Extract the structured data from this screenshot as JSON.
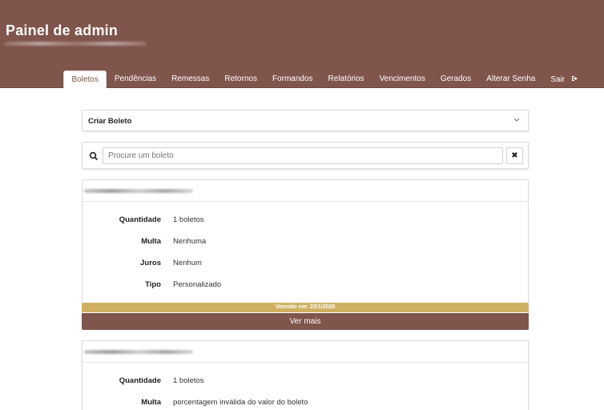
{
  "header": {
    "title": "Painel de admin"
  },
  "nav": {
    "items": [
      {
        "label": "Boletos"
      },
      {
        "label": "Pendências"
      },
      {
        "label": "Remessas"
      },
      {
        "label": "Retornos"
      },
      {
        "label": "Formandos"
      },
      {
        "label": "Relatórios"
      },
      {
        "label": "Vencimentos"
      },
      {
        "label": "Gerados"
      },
      {
        "label": "Alterar Senha"
      },
      {
        "label": "Sair"
      }
    ],
    "active": "Boletos",
    "exit_icon": "sign-out-icon"
  },
  "create": {
    "label": "Criar Boleto",
    "icon": "chevron-down-icon"
  },
  "search": {
    "placeholder": "Procure um boleto",
    "clear_label": "✖",
    "icon": "search-icon"
  },
  "boletos": [
    {
      "fields": [
        {
          "label": "Quantidade",
          "value": "1 boletos"
        },
        {
          "label": "Multa",
          "value": "Nenhuma"
        },
        {
          "label": "Juros",
          "value": "Nenhum"
        },
        {
          "label": "Tipo",
          "value": "Personalizado"
        }
      ],
      "due_text": "Vencido em: 23/1/2020",
      "more_label": "Ver mais"
    },
    {
      "fields": [
        {
          "label": "Quantidade",
          "value": "1 boletos"
        },
        {
          "label": "Multa",
          "value": "porcentagem inválida do valor do boleto"
        }
      ]
    }
  ],
  "colors": {
    "brand": "#80554b",
    "due_banner": "#cfb062"
  }
}
